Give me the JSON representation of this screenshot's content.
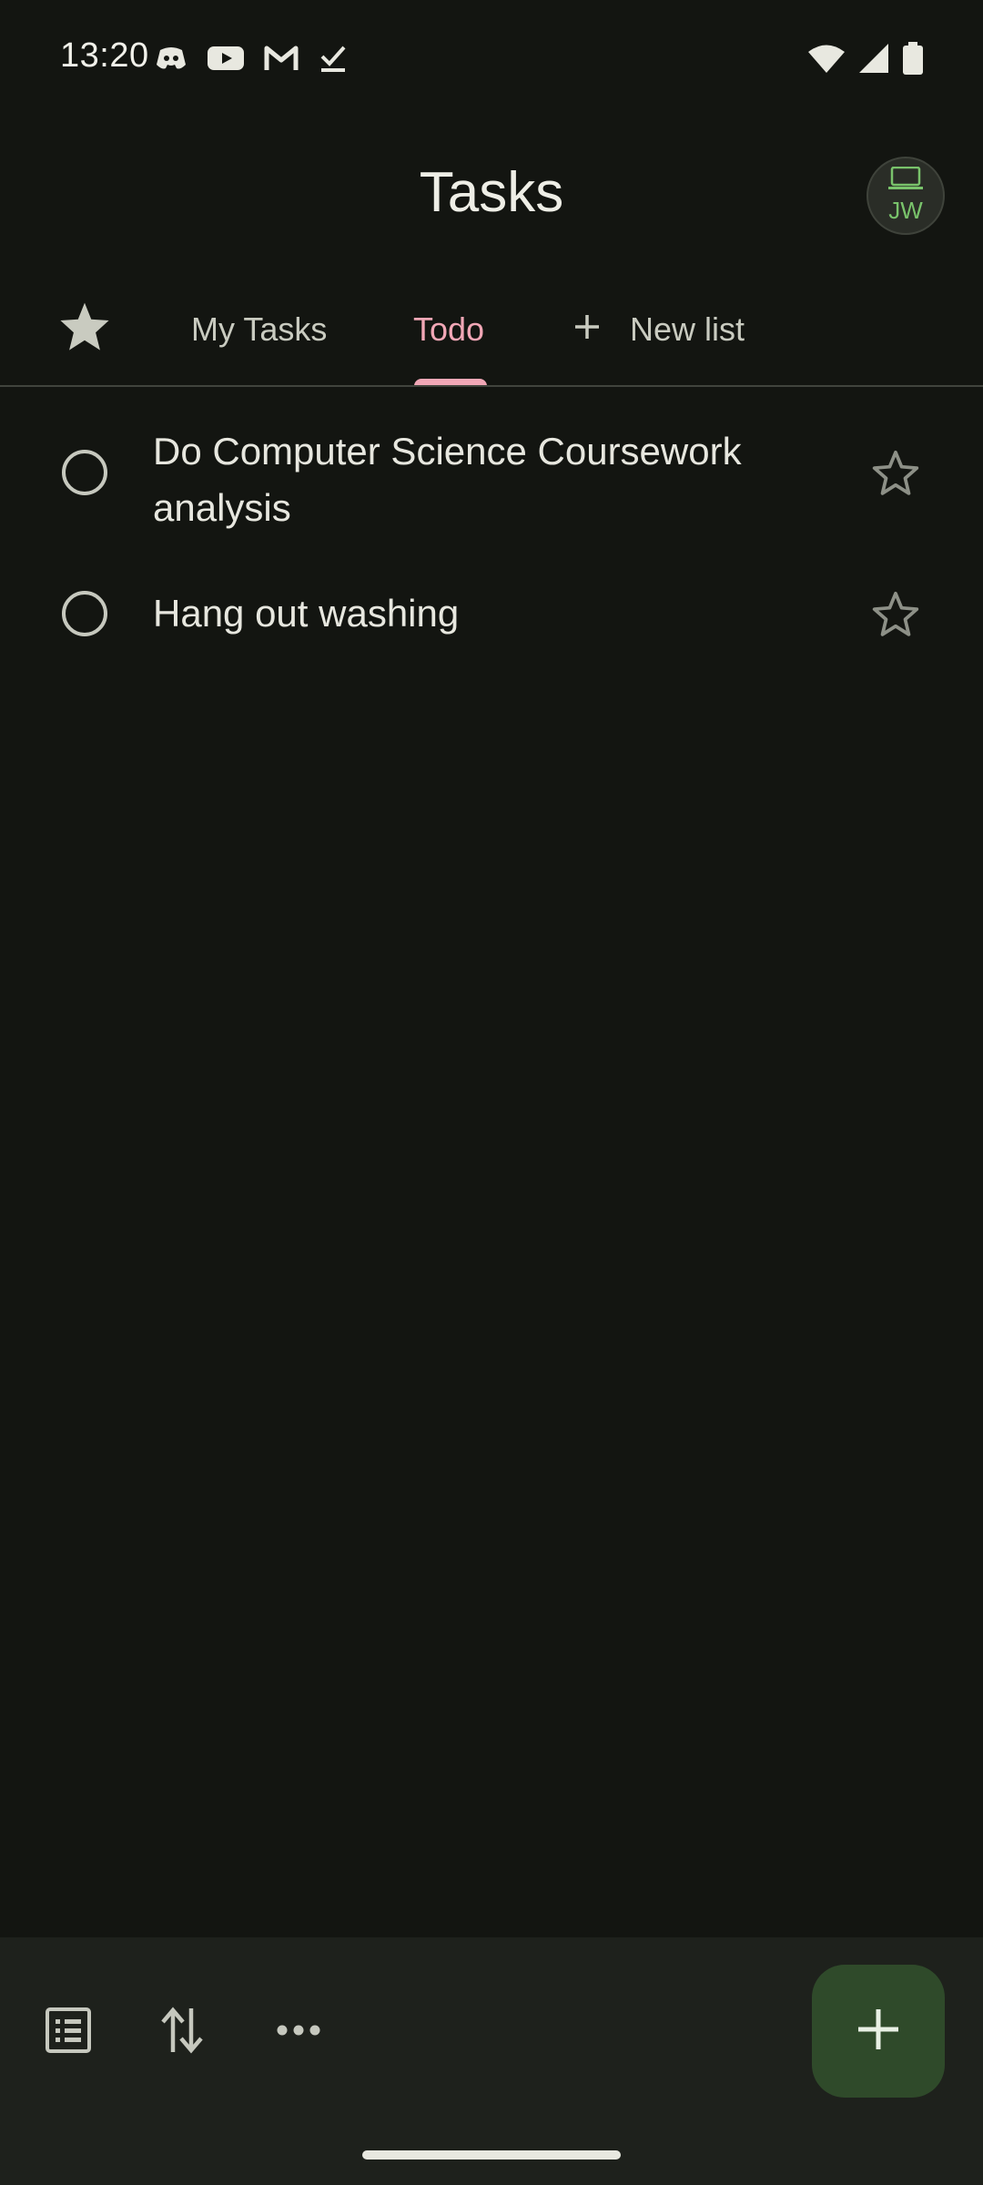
{
  "status_bar": {
    "time": "13:20",
    "left_icons": [
      "discord-icon",
      "youtube-icon",
      "gmail-icon",
      "tasks-check-icon"
    ],
    "right_icons": [
      "wifi-icon",
      "signal-icon",
      "battery-icon"
    ]
  },
  "header": {
    "title": "Tasks",
    "avatar_initials": "JW"
  },
  "tabs": {
    "starred_icon": "star-filled-icon",
    "items": [
      {
        "label": "My Tasks",
        "active": false
      },
      {
        "label": "Todo",
        "active": true
      }
    ],
    "new_list_label": "New list",
    "active_color": "#f1a7b6"
  },
  "tasks": [
    {
      "title": "Do Computer Science Coursework analysis",
      "completed": false,
      "starred": false
    },
    {
      "title": "Hang out washing",
      "completed": false,
      "starred": false
    }
  ],
  "bottom_bar": {
    "icons": [
      "list-view-icon",
      "sort-icon",
      "more-icon"
    ],
    "fab_icon": "add-icon",
    "fab_color": "#2f4a2a"
  }
}
